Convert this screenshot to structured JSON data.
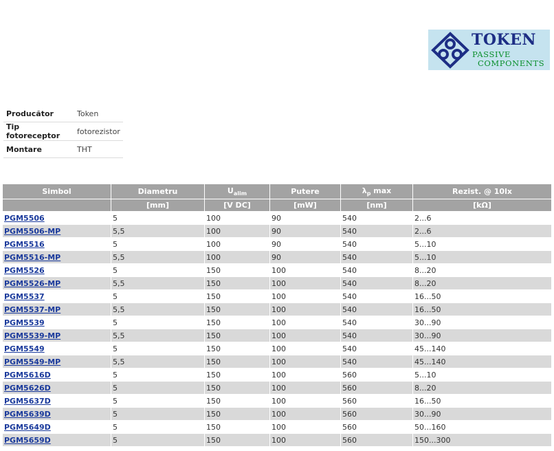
{
  "logo": {
    "brand": "TOKEN",
    "line1": "PASSIVE",
    "line2": "COMPONENTS"
  },
  "properties": [
    {
      "key": "Producător",
      "value": "Token"
    },
    {
      "key": "Tip fotoreceptor",
      "value": "fotorezistor"
    },
    {
      "key": "Montare",
      "value": "THT"
    }
  ],
  "table": {
    "headers": [
      {
        "name": "Simbol",
        "unit": ""
      },
      {
        "name": "Diametru",
        "unit": "[mm]"
      },
      {
        "name": "U",
        "sub": "alim",
        "unit": "[V DC]"
      },
      {
        "name": "Putere",
        "unit": "[mW]"
      },
      {
        "name": "λ",
        "sub": "p",
        "suffix": " max",
        "unit": "[nm]"
      },
      {
        "name": "Rezist. @ 10lx",
        "unit": "[kΩ]"
      }
    ],
    "rows": [
      [
        "PGM5506",
        "5",
        "100",
        "90",
        "540",
        "2...6"
      ],
      [
        "PGM5506-MP",
        "5,5",
        "100",
        "90",
        "540",
        "2...6"
      ],
      [
        "PGM5516",
        "5",
        "100",
        "90",
        "540",
        "5...10"
      ],
      [
        "PGM5516-MP",
        "5,5",
        "100",
        "90",
        "540",
        "5...10"
      ],
      [
        "PGM5526",
        "5",
        "150",
        "100",
        "540",
        "8...20"
      ],
      [
        "PGM5526-MP",
        "5,5",
        "150",
        "100",
        "540",
        "8...20"
      ],
      [
        "PGM5537",
        "5",
        "150",
        "100",
        "540",
        "16...50"
      ],
      [
        "PGM5537-MP",
        "5,5",
        "150",
        "100",
        "540",
        "16...50"
      ],
      [
        "PGM5539",
        "5",
        "150",
        "100",
        "540",
        "30...90"
      ],
      [
        "PGM5539-MP",
        "5,5",
        "150",
        "100",
        "540",
        "30...90"
      ],
      [
        "PGM5549",
        "5",
        "150",
        "100",
        "540",
        "45...140"
      ],
      [
        "PGM5549-MP",
        "5,5",
        "150",
        "100",
        "540",
        "45...140"
      ],
      [
        "PGM5616D",
        "5",
        "150",
        "100",
        "560",
        "5...10"
      ],
      [
        "PGM5626D",
        "5",
        "150",
        "100",
        "560",
        "8...20"
      ],
      [
        "PGM5637D",
        "5",
        "150",
        "100",
        "560",
        "16...50"
      ],
      [
        "PGM5639D",
        "5",
        "150",
        "100",
        "560",
        "30...90"
      ],
      [
        "PGM5649D",
        "5",
        "150",
        "100",
        "560",
        "50...160"
      ],
      [
        "PGM5659D",
        "5",
        "150",
        "100",
        "560",
        "150...300"
      ]
    ]
  },
  "colors": {
    "header_bg": "#a3a3a3",
    "row_alt_bg": "#d9d9d9",
    "link": "#1a3a9c",
    "logo_bg": "#c5e3ef",
    "logo_brand": "#1d2e85",
    "logo_tag": "#0a8f2c"
  }
}
